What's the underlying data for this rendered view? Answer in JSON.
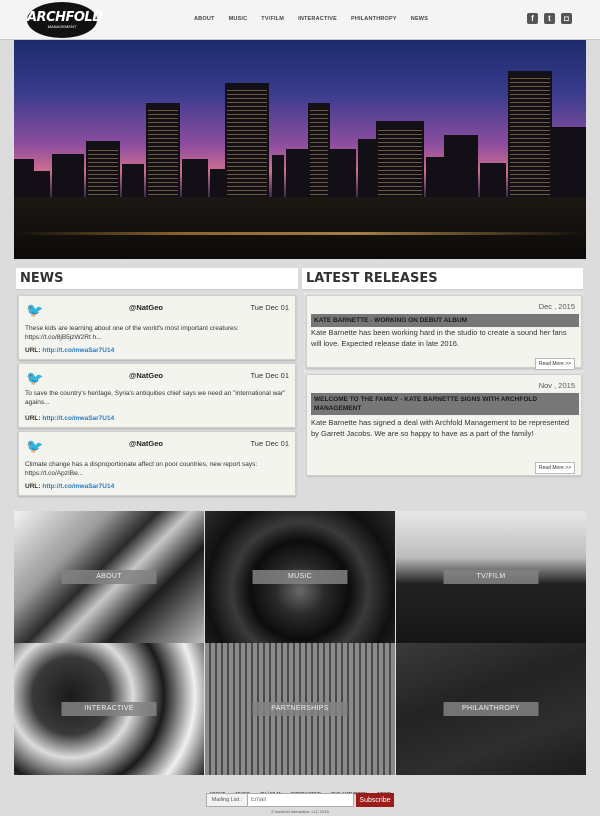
{
  "header": {
    "logo_text": "ARCHFOLD",
    "logo_sub": "MANAGEMENT",
    "nav": [
      "ABOUT",
      "MUSIC",
      "TV/FILM",
      "INTERACTIVE",
      "PHILANTHROPY",
      "NEWS"
    ],
    "social_icons": [
      "facebook-icon",
      "twitter-icon",
      "instagram-icon"
    ]
  },
  "news": {
    "heading": "NEWS",
    "tweets": [
      {
        "handle": "@NatGeo",
        "date": "Tue Dec 01",
        "text": "These kids are learning about one of the world's most important creatures: https://t.co/8jB5jzW2Rt h...",
        "url_label": "URL:",
        "url": "http://t.co/mwaSar7U14"
      },
      {
        "handle": "@NatGeo",
        "date": "Tue Dec 01",
        "text": "To save the country's heritage, Syria's antiquities chief says we need an \"international war\" agains...",
        "url_label": "URL:",
        "url": "http://t.co/mwaSar7U14"
      },
      {
        "handle": "@NatGeo",
        "date": "Tue Dec 01",
        "text": "Climate change has a disproportionate affect on poor countries, new report says: https://t.co/ApzIBe...",
        "url_label": "URL:",
        "url": "http://t.co/mwaSar7U14"
      }
    ]
  },
  "releases": {
    "heading": "LATEST RELEASES",
    "items": [
      {
        "date": "Dec , 2015",
        "title": "KATE BARNETTE - WORKING ON DEBUT ALBUM",
        "text": "Kate Barnette has been working hard in the studio to create a sound her fans will love. Expected release date in late 2016.",
        "more": "Read More >>"
      },
      {
        "date": "Nov , 2015",
        "title": "WELCOME TO THE FAMILY - KATE BARNETTE SIGNS WITH ARCHFOLD MANAGEMENT",
        "text": "Kate Barnette has signed a deal with Archfold Management to be represented by Garrett Jacobs. We are so happy to have as a part of the family!",
        "more": "Read More >>"
      }
    ]
  },
  "tiles": [
    "ABOUT",
    "MUSIC",
    "TV/FILM",
    "INTERACTIVE",
    "PARTNERSHIPS",
    "PHILANTHROPY"
  ],
  "footer": {
    "nav": [
      "ABOUT",
      "MUSIC",
      "TV / FILM",
      "INTERACTIVE",
      "PHILANTHROPY",
      "NEWS"
    ],
    "mailing_label": "Mailing List :",
    "email_placeholder": "Email",
    "subscribe": "Subscribe",
    "copyright": "© Archfold Interactive, LLC 2015"
  },
  "colors": {
    "accent": "#9b1a1a",
    "link": "#2a7cc0",
    "twitter": "#2a8fd8"
  }
}
